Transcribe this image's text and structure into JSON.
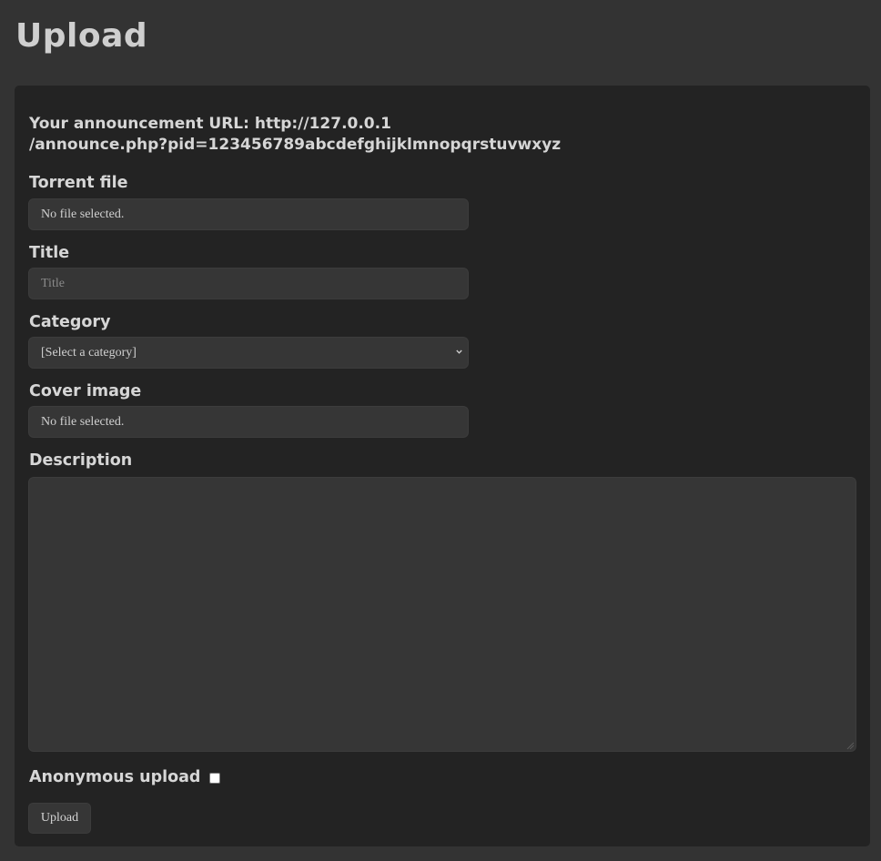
{
  "page": {
    "title": "Upload"
  },
  "form": {
    "announce_line1": "Your announcement URL: http://127.0.0.1",
    "announce_line2": "/announce.php?pid=123456789abcdefghijklmnopqrstuvwxyz",
    "torrent_file": {
      "label": "Torrent file",
      "status": "No file selected."
    },
    "title": {
      "label": "Title",
      "placeholder": "Title",
      "value": ""
    },
    "category": {
      "label": "Category",
      "selected": "[Select a category]"
    },
    "cover_image": {
      "label": "Cover image",
      "status": "No file selected."
    },
    "description": {
      "label": "Description",
      "value": ""
    },
    "anonymous": {
      "label": "Anonymous upload",
      "checked": false
    },
    "submit_label": "Upload"
  },
  "icons": {
    "select_arrow": "chevron-down-icon",
    "resize_handle": "resize-grip-icon"
  },
  "colors": {
    "page_background": "#333333",
    "panel_background": "#232323",
    "input_background": "#363636",
    "text": "#d6d6d6",
    "placeholder_text": "#8a8a8a"
  }
}
